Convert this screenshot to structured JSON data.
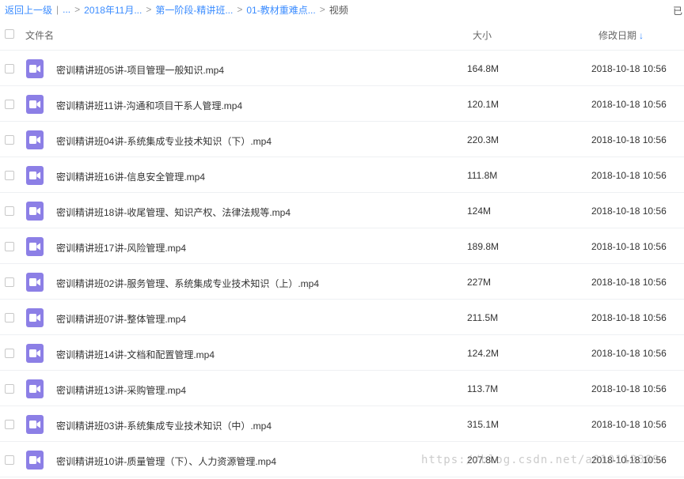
{
  "breadcrumb": {
    "back": "返回上一级",
    "ellipsis": "...",
    "items": [
      "2018年11月...",
      "第一阶段-精讲班...",
      "01-教材重难点..."
    ],
    "current": "视频",
    "separator": ">",
    "divider": "|"
  },
  "top_right_text": "已",
  "header": {
    "name_label": "文件名",
    "size_label": "大小",
    "date_label": "修改日期",
    "sort_arrow": "↓"
  },
  "files": [
    {
      "name": "密训精讲班05讲-项目管理一般知识.mp4",
      "size": "164.8M",
      "date": "2018-10-18 10:56"
    },
    {
      "name": "密训精讲班11讲-沟通和项目干系人管理.mp4",
      "size": "120.1M",
      "date": "2018-10-18 10:56"
    },
    {
      "name": "密训精讲班04讲-系统集成专业技术知识（下）.mp4",
      "size": "220.3M",
      "date": "2018-10-18 10:56"
    },
    {
      "name": "密训精讲班16讲-信息安全管理.mp4",
      "size": "111.8M",
      "date": "2018-10-18 10:56"
    },
    {
      "name": "密训精讲班18讲-收尾管理、知识产权、法律法规等.mp4",
      "size": "124M",
      "date": "2018-10-18 10:56"
    },
    {
      "name": "密训精讲班17讲-风险管理.mp4",
      "size": "189.8M",
      "date": "2018-10-18 10:56"
    },
    {
      "name": "密训精讲班02讲-服务管理、系统集成专业技术知识（上）.mp4",
      "size": "227M",
      "date": "2018-10-18 10:56"
    },
    {
      "name": "密训精讲班07讲-整体管理.mp4",
      "size": "211.5M",
      "date": "2018-10-18 10:56"
    },
    {
      "name": "密训精讲班14讲-文档和配置管理.mp4",
      "size": "124.2M",
      "date": "2018-10-18 10:56"
    },
    {
      "name": "密训精讲班13讲-采购管理.mp4",
      "size": "113.7M",
      "date": "2018-10-18 10:56"
    },
    {
      "name": "密训精讲班03讲-系统集成专业技术知识（中）.mp4",
      "size": "315.1M",
      "date": "2018-10-18 10:56"
    },
    {
      "name": "密训精讲班10讲-质量管理（下）、人力资源管理.mp4",
      "size": "207.8M",
      "date": "2018-10-18 10:56"
    }
  ],
  "file_icon": "video-file-icon",
  "colors": {
    "accent": "#3b8cff",
    "video_icon": "#8c7fe6",
    "divider": "#eef0f3"
  },
  "watermark": "https://blog.csdn.net/a010112389"
}
